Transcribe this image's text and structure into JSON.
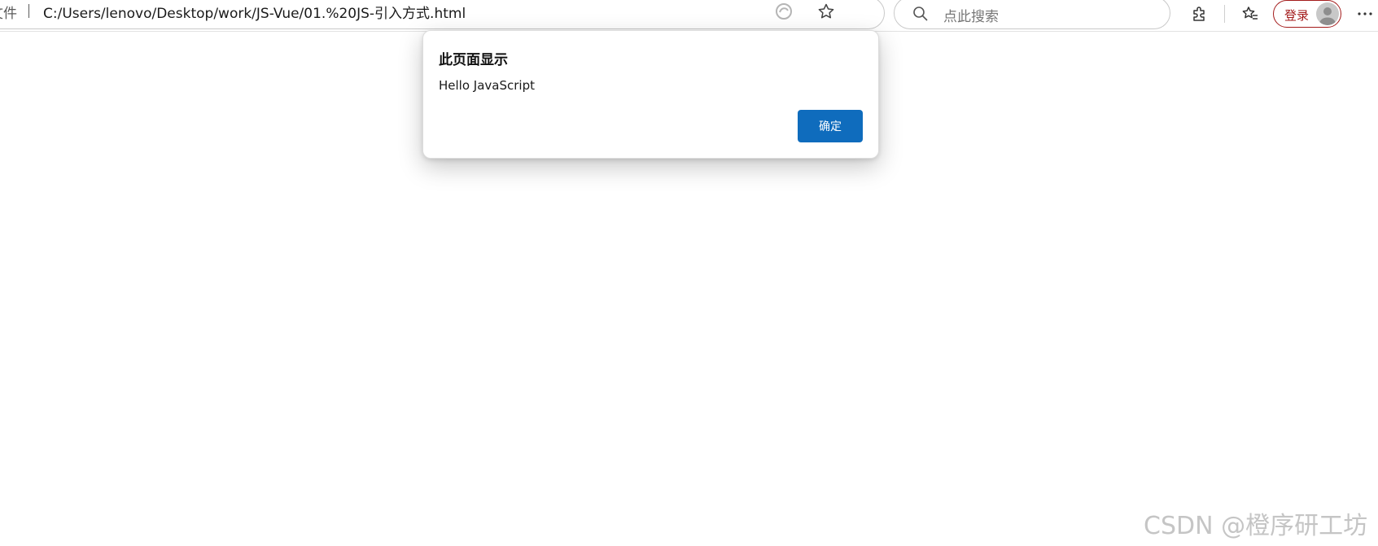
{
  "browser": {
    "address_bar": {
      "scheme_label": "文件",
      "url": "C:/Users/lenovo/Desktop/work/JS-Vue/01.%20JS-引入方式.html",
      "icons": [
        "info-icon",
        "read-aloud-icon",
        "favorite-star-icon"
      ]
    },
    "search": {
      "placeholder": "点此搜索",
      "icon": "search-icon"
    },
    "toolbar_icons": [
      "extensions-icon",
      "favorites-icon",
      "more-options-icon"
    ],
    "login": {
      "label": "登录",
      "avatar_icon": "avatar-icon",
      "accent_color": "#a31a1a"
    }
  },
  "dialog": {
    "title": "此页面显示",
    "message": "Hello JavaScript",
    "ok_label": "确定",
    "button_color": "#0f6cbd"
  },
  "watermark": "CSDN @橙序研工坊"
}
